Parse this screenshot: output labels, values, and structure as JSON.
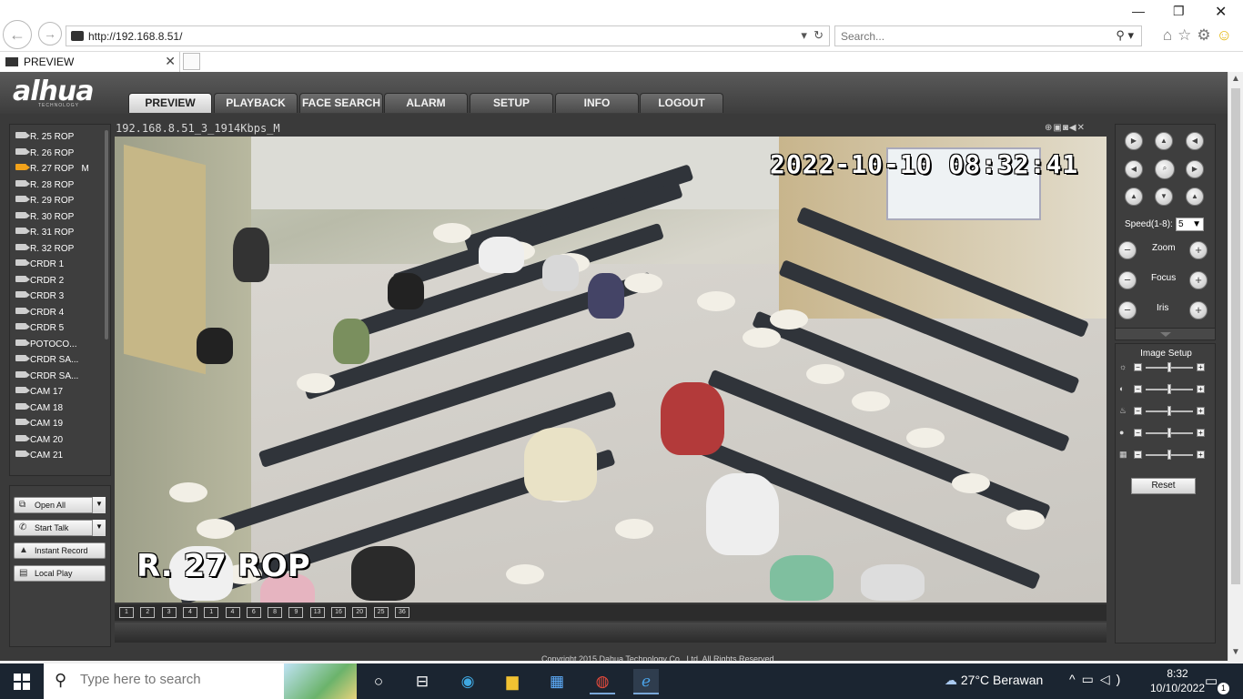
{
  "browser": {
    "url": "http://192.168.8.51/",
    "search_placeholder": "Search...",
    "tab_title": "PREVIEW"
  },
  "app": {
    "logo": "álhua",
    "logo_sub": "TECHNOLOGY",
    "menu": [
      "PREVIEW",
      "PLAYBACK",
      "FACE SEARCH",
      "ALARM",
      "SETUP",
      "INFO",
      "LOGOUT"
    ],
    "active_menu": "PREVIEW",
    "channels": [
      {
        "label": "R. 25 ROP",
        "active": false
      },
      {
        "label": "R. 26 ROP",
        "active": false
      },
      {
        "label": "R. 27 ROP   M",
        "active": true
      },
      {
        "label": "R. 28 ROP",
        "active": false
      },
      {
        "label": "R. 29 ROP",
        "active": false
      },
      {
        "label": "R. 30 ROP",
        "active": false
      },
      {
        "label": "R. 31 ROP",
        "active": false
      },
      {
        "label": "R. 32 ROP",
        "active": false
      },
      {
        "label": "CRDR 1",
        "active": false
      },
      {
        "label": "CRDR 2",
        "active": false
      },
      {
        "label": "CRDR 3",
        "active": false
      },
      {
        "label": "CRDR 4",
        "active": false
      },
      {
        "label": "CRDR 5",
        "active": false
      },
      {
        "label": "POTOCO...",
        "active": false
      },
      {
        "label": "CRDR SA...",
        "active": false
      },
      {
        "label": "CRDR SA...",
        "active": false
      },
      {
        "label": "CAM 17",
        "active": false
      },
      {
        "label": "CAM 18",
        "active": false
      },
      {
        "label": "CAM 19",
        "active": false
      },
      {
        "label": "CAM 20",
        "active": false
      },
      {
        "label": "CAM 21",
        "active": false
      }
    ],
    "actions": {
      "open_all": "Open All",
      "start_talk": "Start Talk",
      "instant_record": "Instant Record",
      "local_play": "Local Play"
    },
    "video": {
      "title": "192.168.8.51_3_1914Kbps_M",
      "timestamp": "2022-10-10  08:32:41",
      "osd_name": "R. 27 ROP"
    },
    "layout_buttons": [
      "1",
      "2",
      "3",
      "4",
      "1",
      "4",
      "6",
      "8",
      "9",
      "13",
      "16",
      "20",
      "25",
      "36"
    ],
    "ptz": {
      "speed_label": "Speed(1-8):",
      "speed_value": "5",
      "zoom_label": "Zoom",
      "focus_label": "Focus",
      "iris_label": "Iris"
    },
    "image_setup": {
      "title": "Image Setup",
      "sliders": [
        {
          "icon": "brightness-icon",
          "glyph": "☼",
          "value": 0.5
        },
        {
          "icon": "contrast-icon",
          "glyph": "◐",
          "value": 0.5
        },
        {
          "icon": "saturation-icon",
          "glyph": "♨",
          "value": 0.5
        },
        {
          "icon": "hue-icon",
          "glyph": "●",
          "value": 0.5
        },
        {
          "icon": "sharpness-icon",
          "glyph": "▦",
          "value": 0.5
        }
      ],
      "reset_label": "Reset"
    },
    "copyright": "Copyright 2015 Dahua Technology Co., Ltd. All Rights Reserved."
  },
  "taskbar": {
    "search_placeholder": "Type here to search",
    "weather": "27°C  Berawan",
    "time": "8:32",
    "date": "10/10/2022",
    "notifications": "1"
  }
}
